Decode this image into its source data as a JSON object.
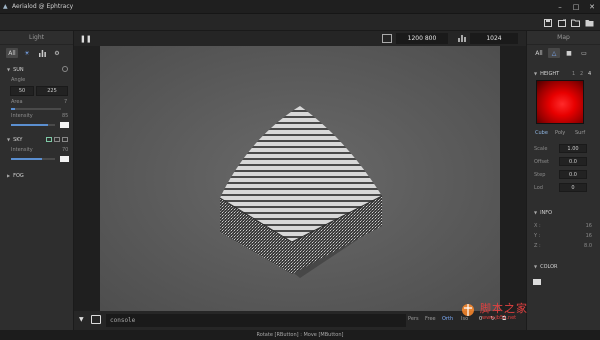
{
  "window": {
    "title": "Aerialod @ Ephtracy",
    "controls": [
      "–",
      "□",
      "✕"
    ]
  },
  "toolbar": {
    "icons": [
      "save-icon",
      "save-as-icon",
      "open-folder-icon",
      "folder-icon"
    ]
  },
  "left_panel": {
    "title": "Light",
    "tabs": [
      {
        "label": "All",
        "active": true
      },
      {
        "label": "☀",
        "active": false
      },
      {
        "label": "▮",
        "active": false
      },
      {
        "label": "⚙",
        "active": false
      }
    ],
    "sun": {
      "label": "SUN",
      "angle_label": "Angle",
      "angle_values": [
        "50",
        "225"
      ],
      "area_label": "Area",
      "area_value": "7",
      "intensity_label": "Intensity",
      "intensity_value": "85",
      "intensity_level": 0.85
    },
    "sky": {
      "label": "SKY",
      "intensity_label": "Intensity",
      "intensity_value": "70",
      "intensity_level": 0.7
    },
    "fog": {
      "label": "FOG"
    }
  },
  "viewport_top": {
    "resolution": "1200  800",
    "samples": "1024"
  },
  "bottom": {
    "console_placeholder": "console",
    "modes": [
      {
        "label": "Pers",
        "on": false
      },
      {
        "label": "Free",
        "on": false
      },
      {
        "label": "Orth",
        "on": true
      },
      {
        "label": "Iso",
        "on": false
      }
    ],
    "count": "0"
  },
  "status": "Rotate [RButton] : Move [MButton]",
  "right_panel": {
    "title": "Map",
    "tabs": [
      {
        "label": "All"
      }
    ],
    "height": {
      "label": "HEIGHT",
      "nums": [
        "1",
        "2",
        "4"
      ],
      "modes": [
        {
          "label": "Cube",
          "on": true
        },
        {
          "label": "Poly",
          "on": false
        },
        {
          "label": "Surf",
          "on": false
        }
      ],
      "fields": [
        {
          "label": "Scale",
          "value": "1.00"
        },
        {
          "label": "Offset",
          "value": "0.0"
        },
        {
          "label": "Step",
          "value": "0.0"
        },
        {
          "label": "Lod",
          "value": "0"
        }
      ]
    },
    "info": {
      "label": "INFO",
      "rows": [
        {
          "label": "X :",
          "value": "16"
        },
        {
          "label": "Y :",
          "value": "16"
        },
        {
          "label": "Z :",
          "value": "8.0"
        }
      ]
    },
    "color": {
      "label": "COLOR"
    }
  },
  "watermark": {
    "text_cn": "脚本之家",
    "url": "www.jb51.net"
  }
}
